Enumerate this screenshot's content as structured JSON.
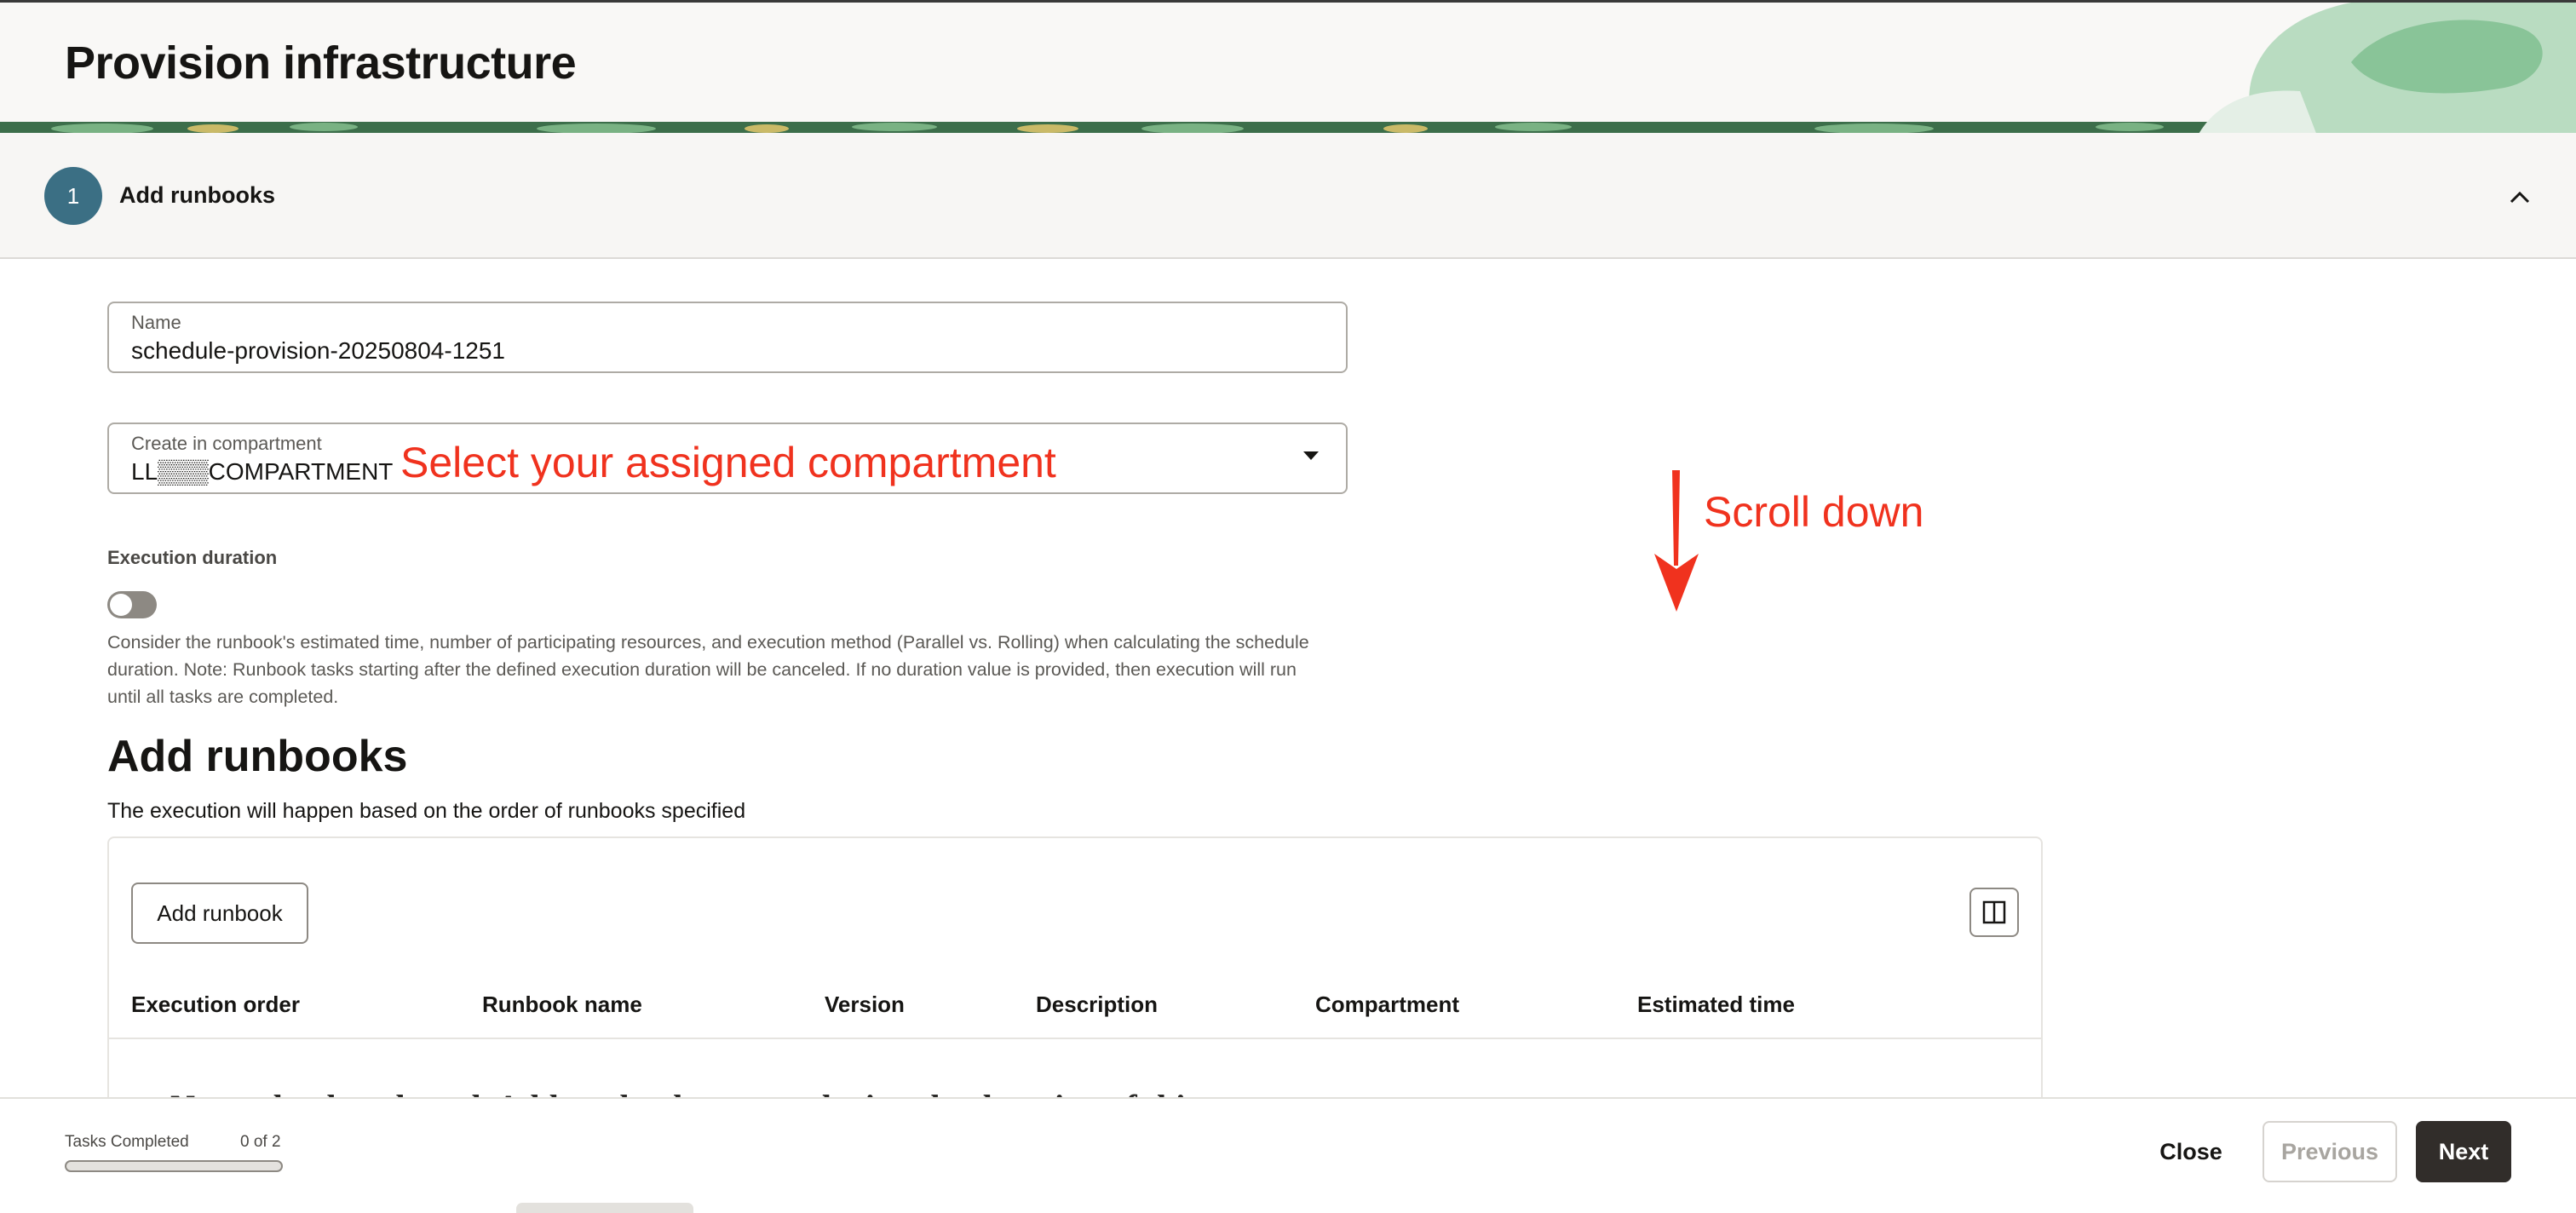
{
  "header": {
    "title": "Provision infrastructure"
  },
  "step": {
    "number": "1",
    "title": "Add runbooks"
  },
  "form": {
    "name": {
      "label": "Name",
      "value": "schedule-provision-20250804-1251"
    },
    "compartment": {
      "label": "Create in compartment",
      "value": "LL▒▒▒COMPARTMENT"
    },
    "execution_duration": {
      "label": "Execution duration",
      "toggle_on": false,
      "help": "Consider the runbook's estimated time, number of participating resources, and execution method (Parallel vs. Rolling) when calculating the schedule duration. Note: Runbook tasks starting after the defined execution duration will be canceled. If no duration value is provided, then execution will run until all tasks are completed."
    }
  },
  "annotations": {
    "compartment_hint": "Select your assigned compartment",
    "scroll_hint": "Scroll down",
    "color": "#f0321e"
  },
  "runbooks": {
    "title": "Add runbooks",
    "subtitle": "The execution will happen based on the order of runbooks specified",
    "add_button": "Add runbook",
    "columns_icon": "column-toggle-icon",
    "columns": [
      "Execution order",
      "Runbook name",
      "Version",
      "Description",
      "Compartment",
      "Estimated time"
    ],
    "empty_text": "No runbooks selected. Add runbooks to run during the duration of this"
  },
  "footer": {
    "tasks_label": "Tasks Completed",
    "tasks_count": "0 of 2",
    "progress": 0,
    "close": "Close",
    "previous": "Previous",
    "next": "Next"
  },
  "colors": {
    "accent": "#3b6f84",
    "primary_button": "#312d2a"
  }
}
